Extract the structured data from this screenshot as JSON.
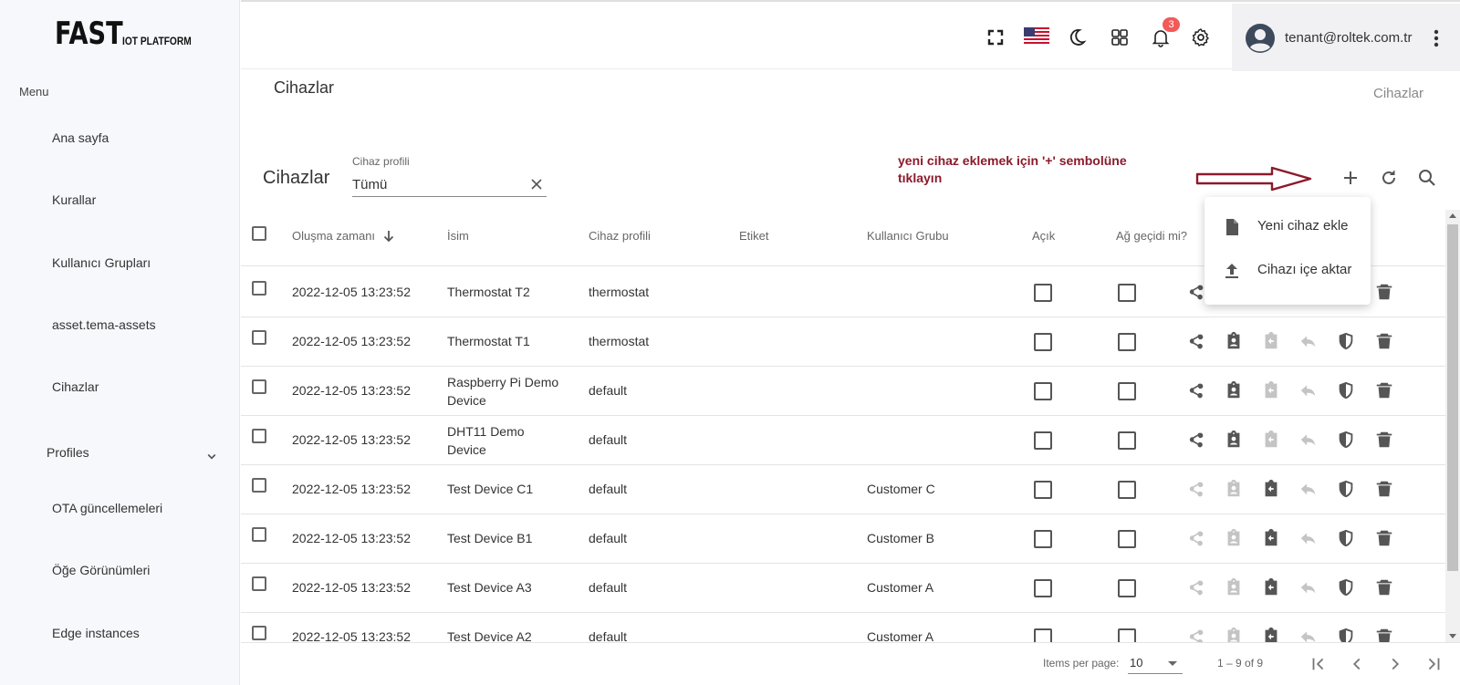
{
  "brand": {
    "main": "FAST",
    "sub": "IOT PLATFORM"
  },
  "sidebar": {
    "menu_label": "Menu",
    "items": [
      {
        "label": "Ana sayfa"
      },
      {
        "label": "Kurallar"
      },
      {
        "label": "Kullanıcı Grupları"
      },
      {
        "label": "asset.tema-assets"
      },
      {
        "label": "Cihazlar"
      },
      {
        "label": "Profiles"
      },
      {
        "label": "OTA güncellemeleri"
      },
      {
        "label": "Öğe Görünümleri"
      },
      {
        "label": "Edge instances"
      }
    ]
  },
  "topbar": {
    "notification_count": "3",
    "user_email": "tenant@roltek.com.tr"
  },
  "page": {
    "title": "Cihazlar",
    "breadcrumb": "Cihazlar"
  },
  "toolbar": {
    "table_title": "Cihazlar",
    "filter_label": "Cihaz profili",
    "filter_value": "Tümü",
    "annotation": "yeni cihaz eklemek için '+' sembolüne tıklayın"
  },
  "table": {
    "headers": {
      "created": "Oluşma zamanı",
      "name": "İsim",
      "profile": "Cihaz profili",
      "label": "Etiket",
      "group": "Kullanıcı Grubu",
      "public": "Açık",
      "gateway": "Ağ geçidi mi?"
    },
    "rows": [
      {
        "created": "2022-12-05 13:23:52",
        "name": "Thermostat T2",
        "profile": "thermostat",
        "label": "",
        "group": ""
      },
      {
        "created": "2022-12-05 13:23:52",
        "name": "Thermostat T1",
        "profile": "thermostat",
        "label": "",
        "group": ""
      },
      {
        "created": "2022-12-05 13:23:52",
        "name": "Raspberry Pi Demo Device",
        "profile": "default",
        "label": "",
        "group": ""
      },
      {
        "created": "2022-12-05 13:23:52",
        "name": "DHT11 Demo Device",
        "profile": "default",
        "label": "",
        "group": ""
      },
      {
        "created": "2022-12-05 13:23:52",
        "name": "Test Device C1",
        "profile": "default",
        "label": "",
        "group": "Customer C"
      },
      {
        "created": "2022-12-05 13:23:52",
        "name": "Test Device B1",
        "profile": "default",
        "label": "",
        "group": "Customer B"
      },
      {
        "created": "2022-12-05 13:23:52",
        "name": "Test Device A3",
        "profile": "default",
        "label": "",
        "group": "Customer A"
      },
      {
        "created": "2022-12-05 13:23:52",
        "name": "Test Device A2",
        "profile": "default",
        "label": "",
        "group": "Customer A"
      }
    ]
  },
  "dropdown": {
    "items": [
      {
        "label": "Yeni cihaz ekle",
        "icon": "file-icon"
      },
      {
        "label": "Cihazı içe aktar",
        "icon": "upload-icon"
      }
    ]
  },
  "footer": {
    "items_per_page_label": "Items per page:",
    "items_per_page_value": "10",
    "range": "1 – 9 of 9"
  },
  "colors": {
    "annotation": "#8b1a2b",
    "badge": "#f25a5a",
    "icon_active": "#555555",
    "icon_disabled": "#c4c4c4"
  }
}
